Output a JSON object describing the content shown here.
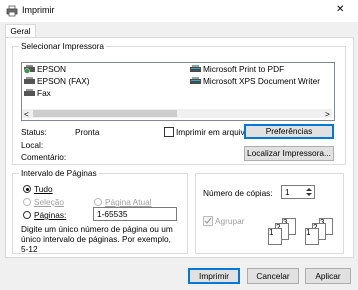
{
  "window": {
    "title": "Imprimir",
    "close_glyph": "✕"
  },
  "tabs": [
    {
      "label": "Geral",
      "selected": true
    }
  ],
  "select_printer": {
    "legend": "Selecionar Impressora",
    "printers": [
      {
        "name": "EPSON",
        "icon": "printer-default-icon",
        "selected": false
      },
      {
        "name": "Microsoft Print to PDF",
        "icon": "printer-icon"
      },
      {
        "name": "EPSON (FAX)",
        "icon": "fax-icon"
      },
      {
        "name": "Microsoft XPS Document Writer",
        "icon": "printer-icon"
      },
      {
        "name": "Fax",
        "icon": "fax-icon"
      }
    ],
    "scroll_left": "<",
    "scroll_right": ">",
    "status_label": "Status:",
    "status_value": "Pronta",
    "location_label": "Local:",
    "location_value": "",
    "comment_label": "Comentário:",
    "comment_value": "",
    "print_to_file_label": "Imprimir em arquivo",
    "print_to_file_checked": false,
    "preferences_button": "Preferências",
    "find_printer_button": "Localizar Impressora..."
  },
  "page_range": {
    "legend": "Intervalo de Páginas",
    "all_label": "Tudo",
    "all_selected": true,
    "selection_label": "Seleção",
    "current_page_label": "Página Atual",
    "pages_label": "Páginas:",
    "pages_value": "1-65535",
    "hint": "Digite um único número de página ou um único intervalo de páginas. Por exemplo, 5-12"
  },
  "copies": {
    "label": "Número de cópias:",
    "value": "1",
    "collate_label": "Agrupar",
    "collate_checked": true,
    "collate_enabled": false,
    "collate_pages": [
      "1",
      "2",
      "3"
    ]
  },
  "footer": {
    "print_button": "Imprimir",
    "cancel_button": "Cancelar",
    "apply_button": "Aplicar"
  },
  "colors": {
    "accent": "#0078d7",
    "disabled": "#a0a0a0",
    "border": "#adadad"
  }
}
